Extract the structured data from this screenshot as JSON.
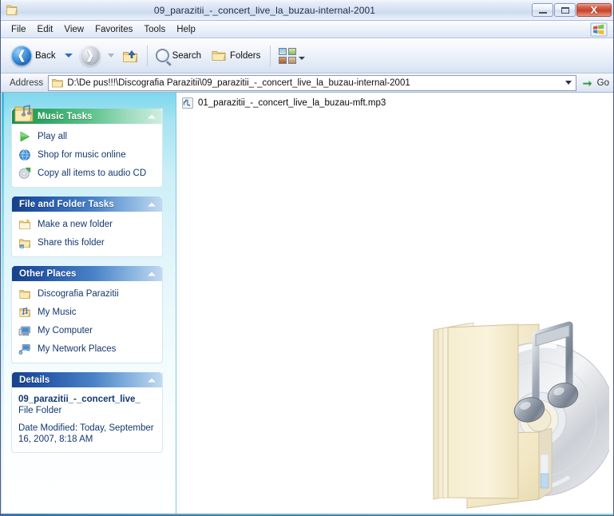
{
  "window": {
    "title": "09_parazitii_-_concert_live_la_buzau-internal-2001",
    "icon": "folder-icon",
    "buttons": {
      "minimize": "–",
      "maximize": "□",
      "close": "X"
    }
  },
  "menubar": {
    "items": [
      {
        "label": "File"
      },
      {
        "label": "Edit"
      },
      {
        "label": "View"
      },
      {
        "label": "Favorites"
      },
      {
        "label": "Tools"
      },
      {
        "label": "Help"
      }
    ],
    "logo": "windows-flag-icon"
  },
  "toolbar": {
    "back_label": "Back",
    "back_icon": "back-arrow-icon",
    "forward_icon": "forward-arrow-icon",
    "up_icon": "up-folder-icon",
    "search_label": "Search",
    "search_icon": "magnifier-icon",
    "folders_label": "Folders",
    "folders_icon": "folder-icon",
    "views_icon": "views-grid-icon"
  },
  "address": {
    "label": "Address",
    "icon": "folder-icon",
    "path": "D:\\De pus!!!\\Discografia Parazitii\\09_parazitii_-_concert_live_la_buzau-internal-2001",
    "go_label": "Go",
    "go_icon": "green-arrow-icon"
  },
  "sidebar": {
    "panels": [
      {
        "id": "music-tasks",
        "title": "Music Tasks",
        "style": "green",
        "badge_icon": "music-folder-icon",
        "collapse_icon": "chevron-up-icon",
        "items": [
          {
            "label": "Play all",
            "icon": "play-green-icon"
          },
          {
            "label": "Shop for music online",
            "icon": "globe-icon"
          },
          {
            "label": "Copy all items to audio CD",
            "icon": "burn-cd-icon"
          }
        ]
      },
      {
        "id": "file-and-folder-tasks",
        "title": "File and Folder Tasks",
        "style": "blue",
        "collapse_icon": "chevron-up-icon",
        "items": [
          {
            "label": "Make a new folder",
            "icon": "new-folder-icon"
          },
          {
            "label": "Share this folder",
            "icon": "share-folder-icon"
          }
        ]
      },
      {
        "id": "other-places",
        "title": "Other Places",
        "style": "blue",
        "collapse_icon": "chevron-up-icon",
        "items": [
          {
            "label": "Discografia Parazitii",
            "icon": "folder-icon"
          },
          {
            "label": "My Music",
            "icon": "my-music-icon"
          },
          {
            "label": "My Computer",
            "icon": "my-computer-icon"
          },
          {
            "label": "My Network Places",
            "icon": "network-places-icon"
          }
        ]
      }
    ],
    "details": {
      "title": "Details",
      "style": "blue",
      "collapse_icon": "chevron-up-icon",
      "name": "09_parazitii_-_concert_live_",
      "type": "File Folder",
      "modified": "Date Modified: Today, September 16, 2007, 8:18 AM"
    }
  },
  "files": {
    "items": [
      {
        "name": "01_parazitii_-_concert_live_la_buzau-mft.mp3",
        "icon": "mp3-file-icon"
      }
    ],
    "watermark_icon": "music-folder-watermark"
  }
}
